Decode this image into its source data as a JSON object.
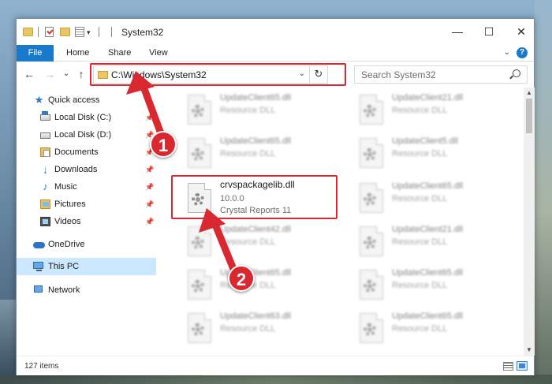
{
  "window": {
    "title": "System32",
    "controls": {
      "minimize": "—",
      "maximize": "☐",
      "close": "✕"
    }
  },
  "quick_access_toolbar": {
    "dropdown": "▾"
  },
  "ribbon": {
    "tabs": [
      "File",
      "Home",
      "Share",
      "View"
    ],
    "expand_chevron": "⌄",
    "help": "?"
  },
  "navigation": {
    "back": "←",
    "forward": "→",
    "recent": "⌄",
    "up": "↑",
    "address_path": "C:\\Windows\\System32",
    "address_dropdown": "⌄",
    "refresh": "↻",
    "search_placeholder": "Search System32"
  },
  "sidebar": {
    "items": [
      {
        "label": "Quick access",
        "icon": "star-icon",
        "pinned": false
      },
      {
        "label": "Local Disk (C:)",
        "icon": "drive-icon",
        "pinned": true
      },
      {
        "label": "Local Disk (D:)",
        "icon": "drive-icon",
        "pinned": true
      },
      {
        "label": "Documents",
        "icon": "documents-icon",
        "pinned": true
      },
      {
        "label": "Downloads",
        "icon": "download-icon",
        "pinned": true
      },
      {
        "label": "Music",
        "icon": "music-icon",
        "pinned": true
      },
      {
        "label": "Pictures",
        "icon": "pictures-icon",
        "pinned": true
      },
      {
        "label": "Videos",
        "icon": "videos-icon",
        "pinned": true
      },
      {
        "label": "OneDrive",
        "icon": "onedrive-icon",
        "pinned": false
      },
      {
        "label": "This PC",
        "icon": "computer-icon",
        "pinned": false,
        "selected": true
      },
      {
        "label": "Network",
        "icon": "network-icon",
        "pinned": false
      }
    ],
    "pin_glyph": "📌"
  },
  "files": {
    "left": [
      {
        "name": "UpdateClient65.dll",
        "desc": "Resource DLL"
      },
      {
        "name": "UpdateClient65.dll",
        "desc": "Resource DLL"
      },
      {
        "name": "crvspackagelib.dll",
        "desc": "10.0.0",
        "desc2": "Crystal Reports 11"
      },
      {
        "name": "UpdateClient42.dll",
        "desc": "Resource DLL"
      },
      {
        "name": "UpdateClient65.dll",
        "desc": "Resource DLL"
      },
      {
        "name": "UpdateClient63.dll",
        "desc": "Resource DLL"
      }
    ],
    "right": [
      {
        "name": "UpdateClient21.dll",
        "desc": "Resource DLL"
      },
      {
        "name": "UpdateClient5.dll",
        "desc": "Resource DLL"
      },
      {
        "name": "UpdateClient65.dll",
        "desc": "Resource DLL"
      },
      {
        "name": "UpdateClient21.dll",
        "desc": "Resource DLL"
      },
      {
        "name": "UpdateClient65.dll",
        "desc": "Resource DLL"
      },
      {
        "name": "UpdateClient65.dll",
        "desc": "Resource DLL"
      }
    ]
  },
  "scrollbar": {
    "up": "▲",
    "down": "▼"
  },
  "status": {
    "item_count": "127 items"
  },
  "annotations": {
    "step1": "1",
    "step2": "2",
    "color": "#d9282f"
  }
}
